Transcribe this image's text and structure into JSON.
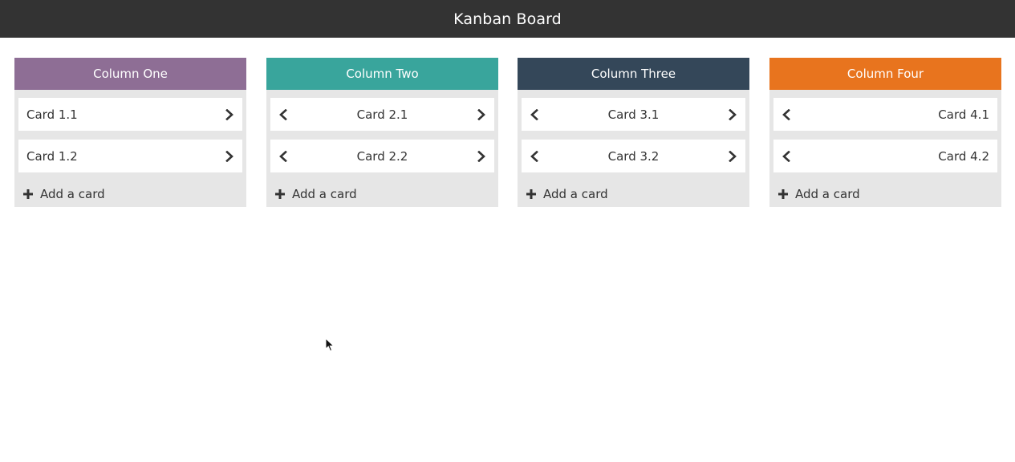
{
  "app": {
    "title": "Kanban Board"
  },
  "columns": [
    {
      "title": "Column One",
      "color": "#8e6e95",
      "cards": [
        {
          "label": "Card 1.1"
        },
        {
          "label": "Card 1.2"
        }
      ],
      "add_label": "Add a card"
    },
    {
      "title": "Column Two",
      "color": "#39a59c",
      "cards": [
        {
          "label": "Card 2.1"
        },
        {
          "label": "Card 2.2"
        }
      ],
      "add_label": "Add a card"
    },
    {
      "title": "Column Three",
      "color": "#344759",
      "cards": [
        {
          "label": "Card 3.1"
        },
        {
          "label": "Card 3.2"
        }
      ],
      "add_label": "Add a card"
    },
    {
      "title": "Column Four",
      "color": "#e8741e",
      "cards": [
        {
          "label": "Card 4.1"
        },
        {
          "label": "Card 4.2"
        }
      ],
      "add_label": "Add a card"
    }
  ],
  "icons": {
    "move_left": "chevron-left-icon",
    "move_right": "chevron-right-icon",
    "add": "plus-icon",
    "pointer": "mouse-cursor-icon"
  },
  "colors": {
    "topbar": "#333333",
    "column_bg": "#e6e6e6",
    "card_bg": "#ffffff"
  }
}
